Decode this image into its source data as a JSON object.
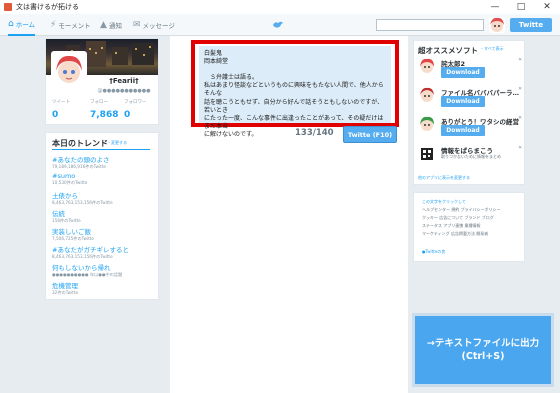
{
  "window": {
    "title": "文は書けるが拓ける"
  },
  "nav": {
    "tabs": [
      {
        "label": "ホーム",
        "icon": "home-icon"
      },
      {
        "label": "モーメント",
        "icon": "lightning-icon"
      },
      {
        "label": "通知",
        "icon": "bell-icon"
      },
      {
        "label": "メッセージ",
        "icon": "envelope-icon"
      }
    ],
    "search": {
      "value": "",
      "placeholder": ""
    },
    "tweet_button": "Twitte"
  },
  "profile": {
    "name": "†Fearii†",
    "handle": "@●●●●●●●●●●●",
    "stats": [
      {
        "label": "ツイート",
        "value": "0"
      },
      {
        "label": "フォロー",
        "value": "7,868"
      },
      {
        "label": "フォロワー",
        "value": "0"
      }
    ]
  },
  "trends": {
    "title": "本日のトレンド",
    "change_link": "・変更する",
    "items": [
      {
        "tag": "#あなたの頭のよさ",
        "sub": "79,189,186,916件のTwitte"
      },
      {
        "tag": "#sumo",
        "sub": "10,530件のTwitte"
      },
      {
        "tag": "土俵から",
        "sub": "8,463,763,153,156件のTwitte"
      },
      {
        "tag": "伝統",
        "sub": "156件のTwitte"
      },
      {
        "tag": "実装しいご飯",
        "sub": "7,506,725件のTwitte"
      },
      {
        "tag": "#あなたがガチギレすると",
        "sub": "8,463,763,153,156件のTwitte"
      },
      {
        "tag": "何もしないから帰れ",
        "sub": "●●●●●●●●●● 年以●●中の話題"
      },
      {
        "tag": "危機管理",
        "sub": "32件のTwitte"
      }
    ]
  },
  "compose": {
    "text": "白髪鬼\n岡本綺堂\n\n　Ｓ弁護士は語る。\n私はあまり怪談などというものに興味をもたない人間で、他人からそんな\n話を聴こうともせず、自分から好んで話そうともしないのですが、若いとき\nにたった一度、こんな事件に出逢ったことがあって、その疑だけはまだ本当\nに解けないのです。",
    "counter": "133/140",
    "submit_label": "Twitte (F10)"
  },
  "recommend": {
    "title": "超オススメソフト",
    "change_link": "・すべて表示",
    "items": [
      {
        "name": "詫太郎2",
        "button": "Download"
      },
      {
        "name": "ファイル名バババパーラ…",
        "button": "Download"
      },
      {
        "name": "ありがとう！ワタシの経営",
        "button": "Download"
      }
    ],
    "info": {
      "title": "情報をぱらまこう",
      "sub": "取りつかないために情報をまとめ"
    },
    "other_link": "他のアプリに表示を変更する"
  },
  "footer": {
    "copyright": "この文字をクリックして",
    "rows": [
      "ヘルプセンター  規約  プライバシーポリシー",
      "クッキー  広告について  ブランド  ブログ",
      "ステータス  アプリ連携  業種情報",
      "マーケティング  広告掲載方法  開発者"
    ],
    "twotan": "●Twitteの良"
  },
  "export": {
    "label": "→テキストファイルに出力\n(Ctrl+S)"
  },
  "colors": {
    "accent": "#1da1f2",
    "compose_highlight": "#e00000",
    "export_bg": "#4aa6ee"
  }
}
